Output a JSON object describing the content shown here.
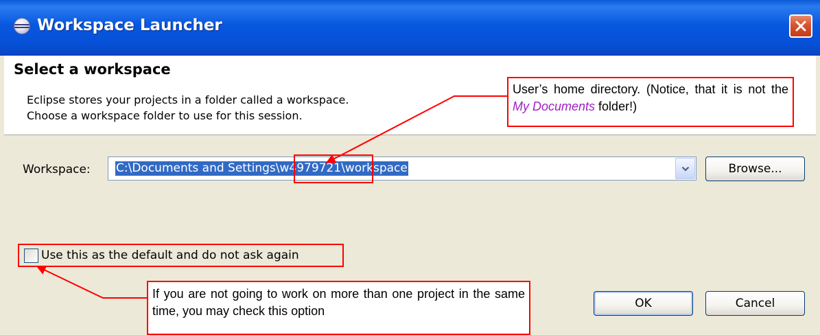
{
  "window": {
    "title": "Workspace Launcher",
    "title_icon": "eclipse-icon",
    "close_icon": "close-icon"
  },
  "header": {
    "title": "Select a workspace",
    "desc_line1": "Eclipse stores your projects in a folder called a workspace.",
    "desc_line2": "Choose a workspace folder to use for this session."
  },
  "workspace": {
    "label": "Workspace:",
    "value": "C:\\Documents and Settings\\w4979721\\workspace",
    "dropdown_icon": "chevron-down-icon",
    "browse_label": "Browse..."
  },
  "default_option": {
    "label": "Use this as the default and do not ask again",
    "checked": false
  },
  "buttons": {
    "ok": "OK",
    "cancel": "Cancel"
  },
  "annotations": {
    "home_dir": {
      "text_before": "User’s home directory. (Notice, that it is not the ",
      "emphasis": "My Documents",
      "text_after": " folder!)"
    },
    "default_hint": "If you are not going to work on more than one project in the same time, you may check this option"
  },
  "colors": {
    "titlebar": "#0858e0",
    "selection": "#316ac5",
    "annotation": "#ff0000",
    "emphasis": "#a020c0"
  }
}
